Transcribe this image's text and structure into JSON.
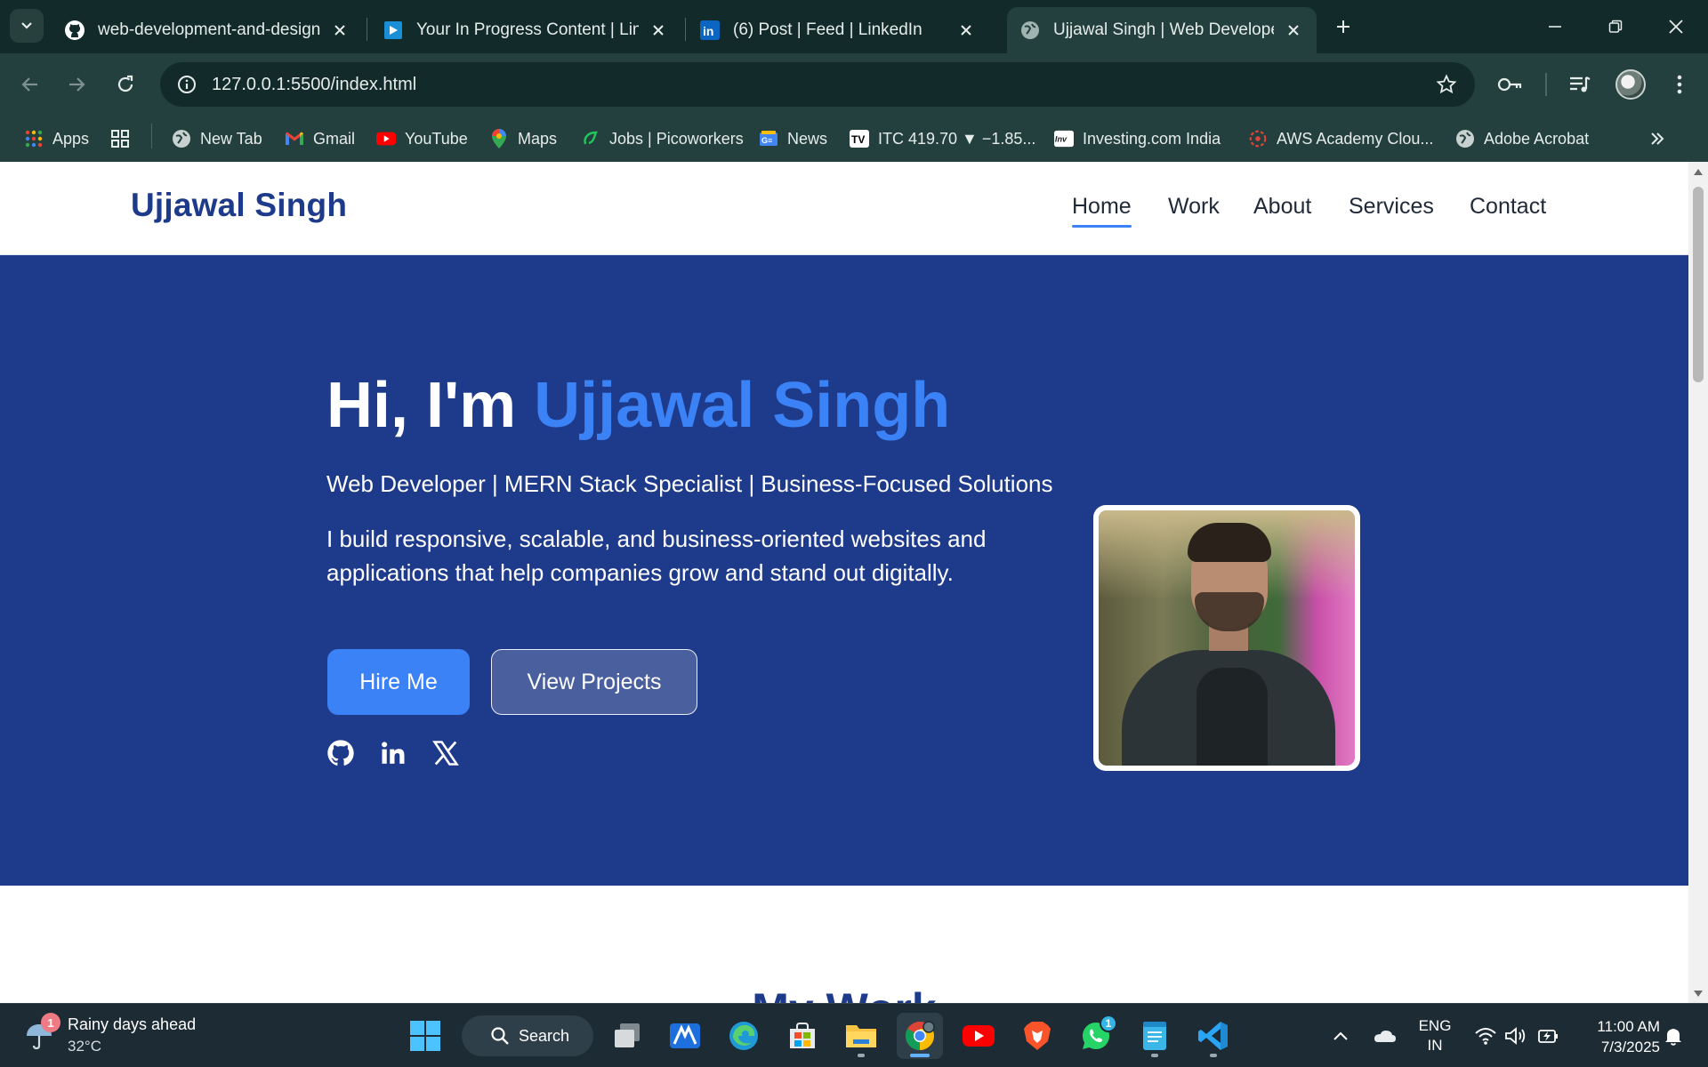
{
  "browser": {
    "tabs": [
      {
        "title": "web-development-and-design-",
        "icon": "github-icon"
      },
      {
        "title": "Your In Progress Content | Linke",
        "icon": "linkedin-learning-icon"
      },
      {
        "title": "(6) Post | Feed | LinkedIn",
        "icon": "linkedin-icon"
      },
      {
        "title": "Ujjawal Singh | Web Developer |",
        "icon": "globe-icon",
        "active": true
      }
    ],
    "url": "127.0.0.1:5500/index.html",
    "bookmarks": [
      {
        "label": "Apps",
        "icon": "apps-grid-icon"
      },
      {
        "label": "",
        "icon": "tab-groups-icon"
      },
      {
        "label": "New Tab",
        "icon": "globe-icon"
      },
      {
        "label": "Gmail",
        "icon": "gmail-icon"
      },
      {
        "label": "YouTube",
        "icon": "youtube-icon"
      },
      {
        "label": "Maps",
        "icon": "maps-pin-icon"
      },
      {
        "label": "Jobs | Picoworkers",
        "icon": "picoworkers-icon"
      },
      {
        "label": "News",
        "icon": "google-news-icon"
      },
      {
        "label": "ITC 419.70 ▼ −1.85...",
        "icon": "tradingview-icon"
      },
      {
        "label": "Investing.com India",
        "icon": "investing-icon"
      },
      {
        "label": "AWS Academy Clou...",
        "icon": "aws-academy-icon"
      },
      {
        "label": "Adobe Acrobat",
        "icon": "globe-icon"
      }
    ]
  },
  "site": {
    "logo": "Ujjawal Singh",
    "nav": [
      "Home",
      "Work",
      "About",
      "Services",
      "Contact"
    ],
    "active_nav": "Home",
    "hero": {
      "greeting": "Hi, I'm ",
      "name": "Ujjawal Singh",
      "tagline": "Web Developer | MERN Stack Specialist | Business-Focused Solutions",
      "description": "I build responsive, scalable, and business-oriented websites and applications that help companies grow and stand out digitally.",
      "primary_button": "Hire Me",
      "secondary_button": "View Projects",
      "socials": [
        "github-icon",
        "linkedin-icon",
        "x-icon"
      ]
    },
    "next_section_heading": "My Work"
  },
  "taskbar": {
    "weather_badge": "1",
    "weather_title": "Rainy days ahead",
    "weather_temp": "32°C",
    "search_label": "Search",
    "whatsapp_badge": "1",
    "lang_top": "ENG",
    "lang_bottom": "IN",
    "time": "11:00 AM",
    "date": "7/3/2025"
  },
  "colors": {
    "brand": "#1e3a8a",
    "accent": "#3b82f6",
    "browser_frame": "#23403e"
  }
}
